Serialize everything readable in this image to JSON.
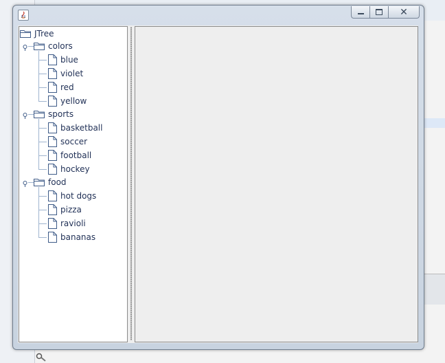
{
  "window": {
    "title": "",
    "controls": {
      "minimize": "minimize",
      "maximize": "maximize",
      "close": "close"
    }
  },
  "tree": {
    "root": "JTree",
    "nodes": [
      {
        "label": "colors",
        "expanded": true,
        "children": [
          "blue",
          "violet",
          "red",
          "yellow"
        ]
      },
      {
        "label": "sports",
        "expanded": true,
        "children": [
          "basketball",
          "soccer",
          "football",
          "hockey"
        ]
      },
      {
        "label": "food",
        "expanded": true,
        "children": [
          "hot dogs",
          "pizza",
          "ravioli",
          "bananas"
        ]
      }
    ]
  },
  "colors": {
    "tree_text": "#1f2f55",
    "tree_line": "#9fb4cf",
    "icon_stroke": "#3d5a87",
    "pane_background": "#eeeeee",
    "window_frame": "#c8d3e0"
  },
  "icons": {
    "app": "java-icon",
    "folder": "folder-icon",
    "leaf": "file-icon",
    "toggle": "expanded-toggle-icon"
  }
}
